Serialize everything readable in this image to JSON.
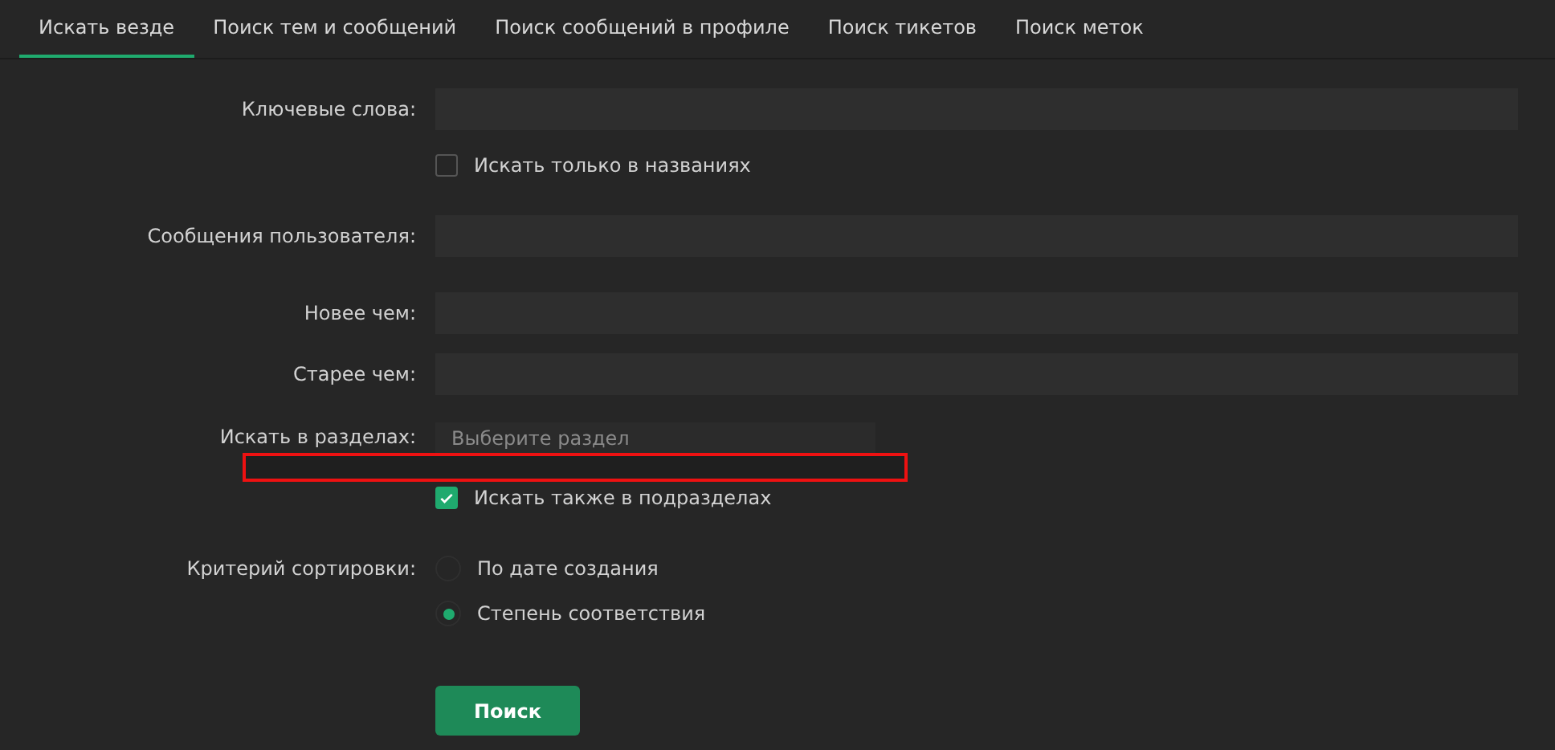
{
  "tabs": [
    {
      "label": "Искать везде",
      "selected": true
    },
    {
      "label": "Поиск тем и сообщений",
      "selected": false
    },
    {
      "label": "Поиск сообщений в профиле",
      "selected": false
    },
    {
      "label": "Поиск тикетов",
      "selected": false
    },
    {
      "label": "Поиск меток",
      "selected": false
    }
  ],
  "rows": [
    {
      "kind": "text",
      "label": "Ключевые слова:"
    },
    {
      "kind": "checkbox",
      "text": "Искать только в названиях",
      "checked": false
    },
    {
      "kind": "text",
      "label": "Сообщения пользователя:"
    },
    {
      "kind": "text",
      "label": "Новее чем:"
    },
    {
      "kind": "text",
      "label": "Старее чем:"
    },
    {
      "kind": "select",
      "label": "Искать в разделах:",
      "placeholder": "Выберите раздел",
      "highlighted": true
    },
    {
      "kind": "checkbox",
      "text": "Искать также в подразделах",
      "checked": true
    },
    {
      "kind": "radio",
      "label": "Критерий сортировки:",
      "options": [
        {
          "text": "По дате создания",
          "selected": false
        },
        {
          "text": "Степень соответствия",
          "selected": true
        }
      ]
    }
  ],
  "submit": "Поиск"
}
